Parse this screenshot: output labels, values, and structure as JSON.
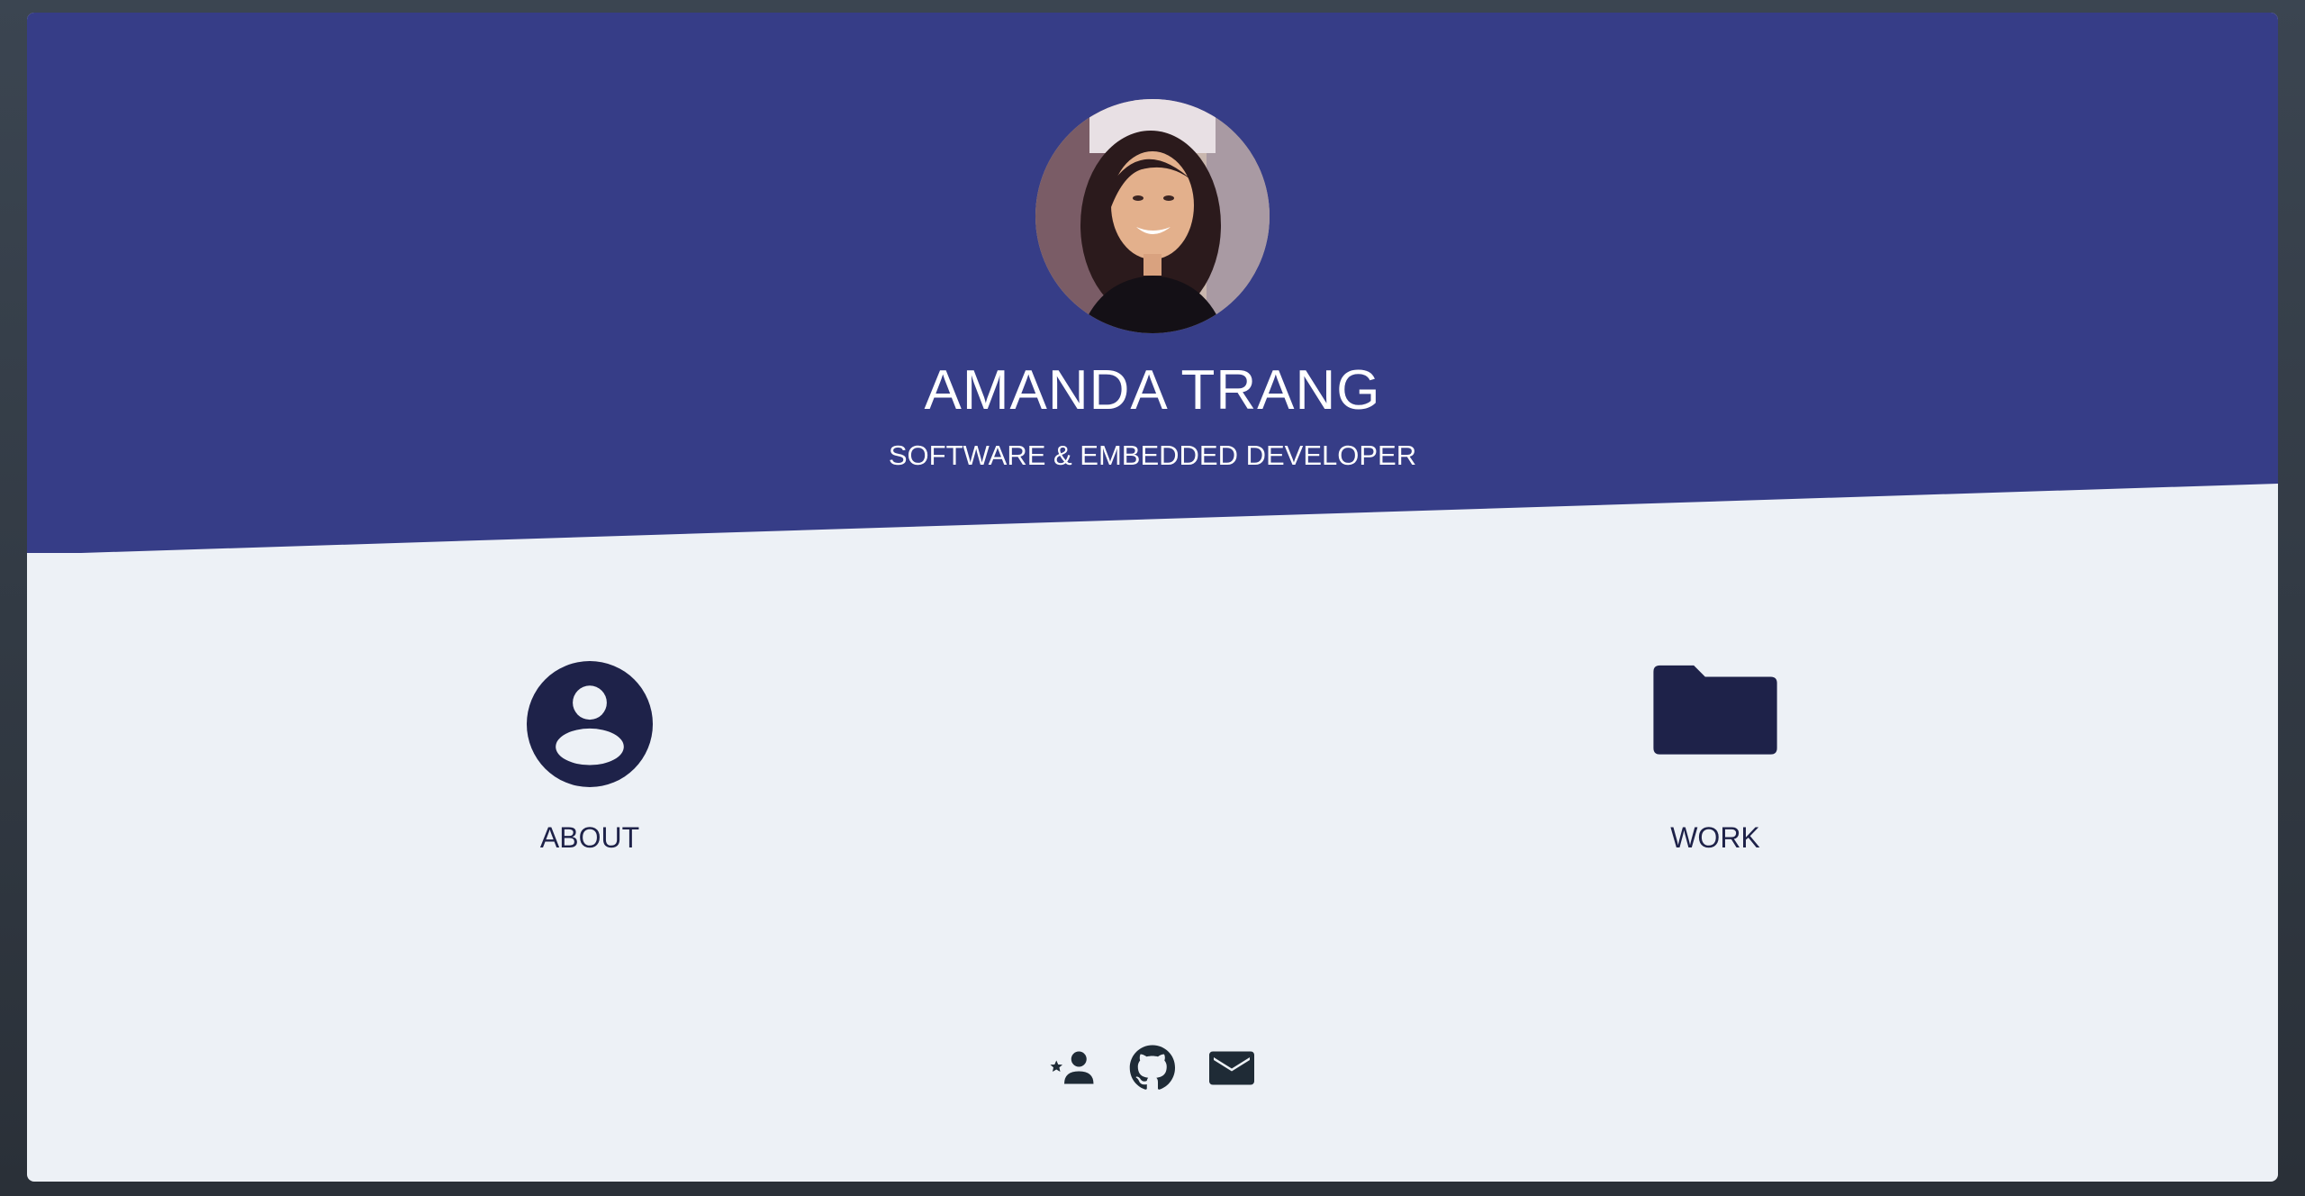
{
  "profile": {
    "name": "AMANDA TRANG",
    "title": "SOFTWARE & EMBEDDED DEVELOPER",
    "photo_icon": "profile-photo"
  },
  "nav": {
    "about": {
      "label": "ABOUT",
      "icon": "account-circle-icon"
    },
    "work": {
      "label": "WORK",
      "icon": "folder-icon"
    }
  },
  "social": [
    {
      "icon": "person-star-icon"
    },
    {
      "icon": "github-icon"
    },
    {
      "icon": "email-icon"
    }
  ],
  "colors": {
    "hero": "#363d87",
    "page": "#edf1f6",
    "icon_dark": "#1e2249",
    "social_icon": "#1f2b36",
    "text_light": "#ffffff"
  }
}
